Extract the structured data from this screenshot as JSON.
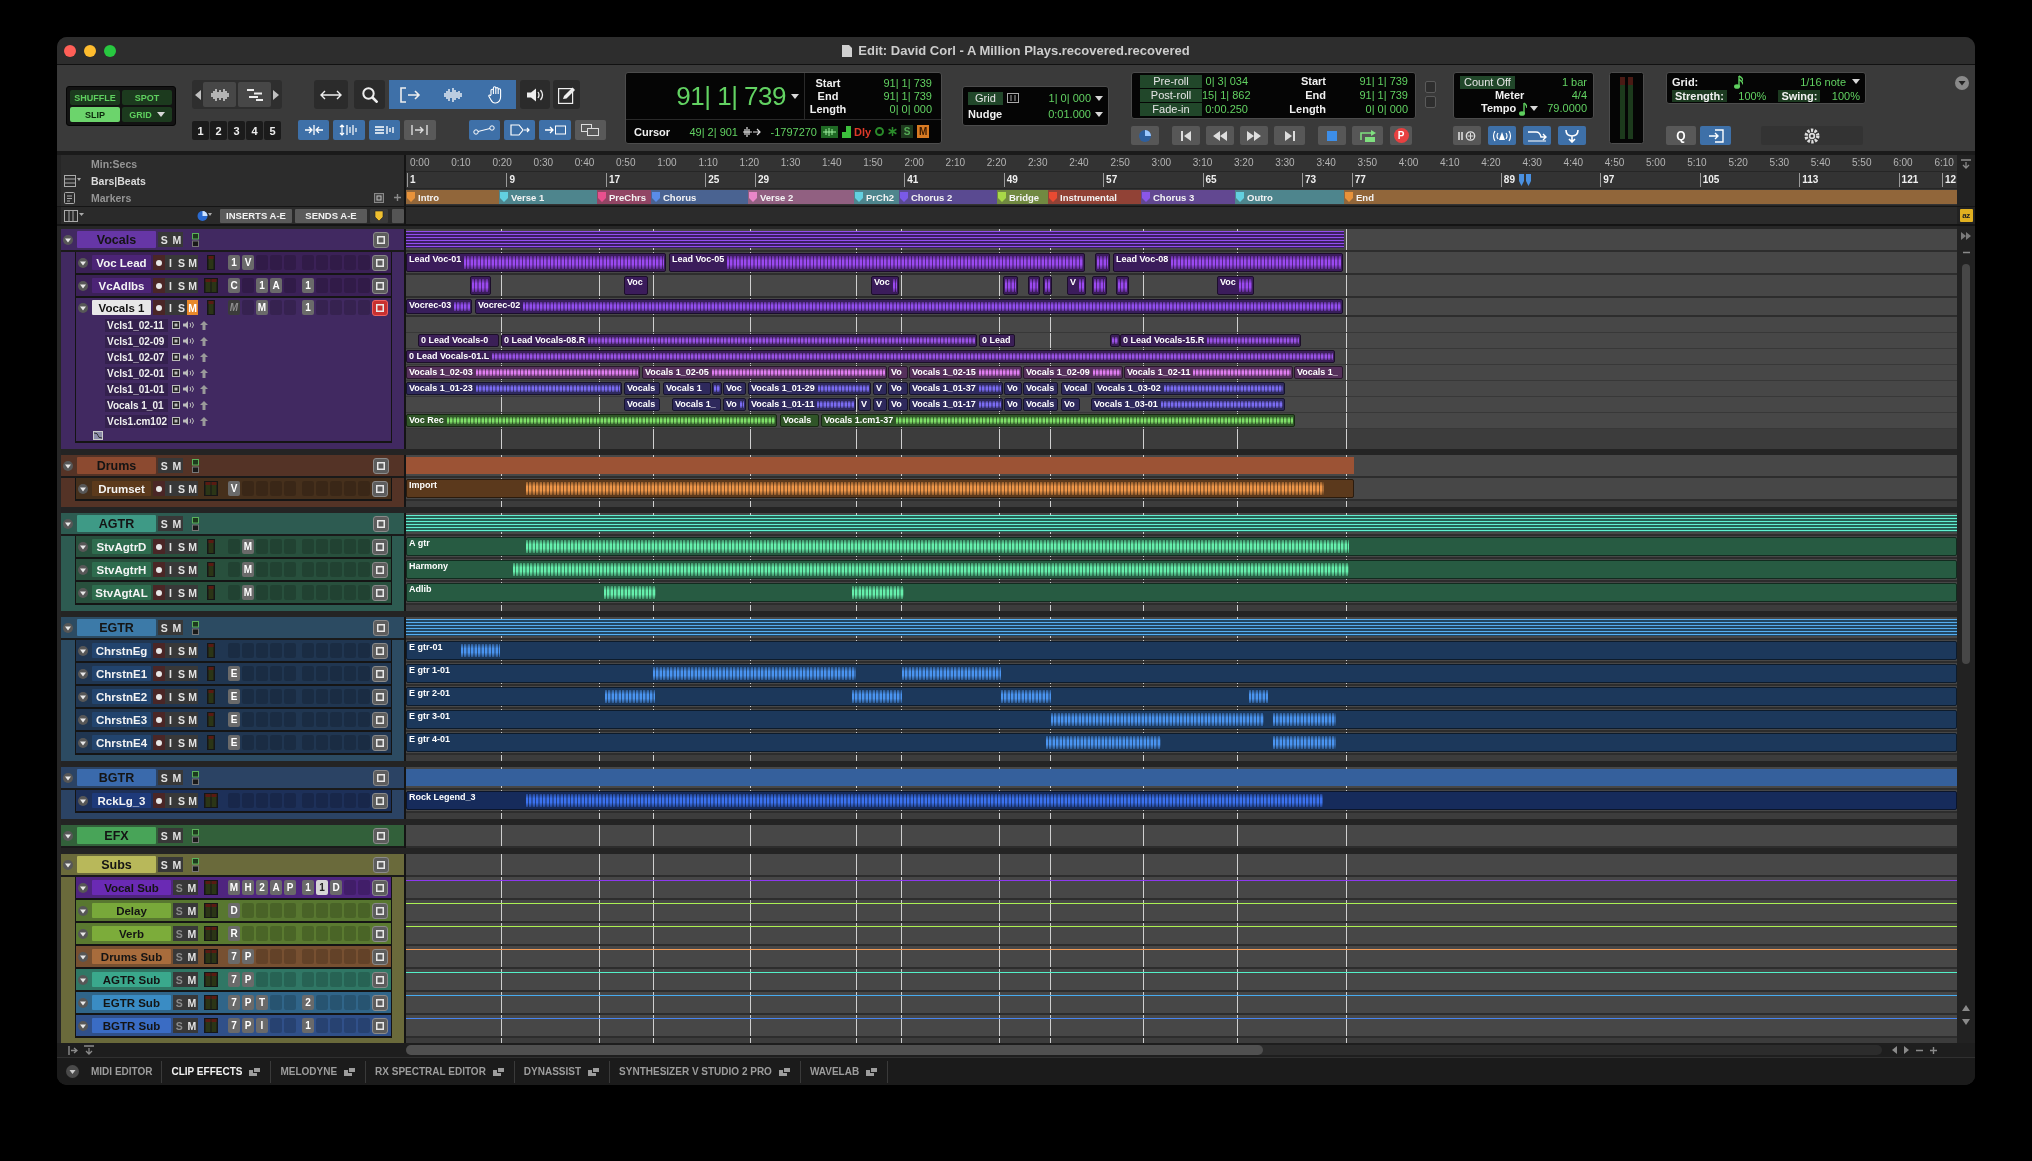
{
  "window": {
    "title": "Edit: David Corl - A Million Plays.recovered.recovered"
  },
  "toolbar": {
    "edit_modes": [
      {
        "label": "SHUFFLE",
        "selected": false,
        "menu": false
      },
      {
        "label": "SPOT",
        "selected": false,
        "menu": false
      },
      {
        "label": "SLIP",
        "selected": true,
        "menu": false
      },
      {
        "label": "GRID",
        "selected": false,
        "menu": true
      }
    ],
    "zoom_presets": [
      "1",
      "2",
      "3",
      "4",
      "5"
    ],
    "tools": [
      {
        "kind": "arrows",
        "selected": false
      },
      {
        "kind": "magnifier",
        "selected": false
      },
      {
        "kind": "trim",
        "selected": true
      },
      {
        "kind": "selector",
        "selected": true
      },
      {
        "kind": "hand",
        "selected": true
      },
      {
        "kind": "speaker",
        "selected": false
      },
      {
        "kind": "pencil",
        "selected": false
      }
    ],
    "edit_toggles": [
      {
        "kind": "split",
        "on": true
      },
      {
        "kind": "updown",
        "on": true
      },
      {
        "kind": "lines",
        "on": true
      },
      {
        "kind": "bracket",
        "on": false
      },
      {
        "kind": "nodes",
        "on": true
      },
      {
        "kind": "tag",
        "on": true
      },
      {
        "kind": "arrowbox",
        "on": true
      },
      {
        "kind": "windows",
        "on": false
      }
    ],
    "counter": {
      "main": "91| 1| 739",
      "rows": [
        {
          "label": "Start",
          "value": "91| 1| 739"
        },
        {
          "label": "End",
          "value": "91| 1| 739"
        },
        {
          "label": "Length",
          "value": "0| 0| 000"
        }
      ],
      "cursor_label": "Cursor",
      "cursor_value": "49| 2| 901",
      "sample_value": "-1797270",
      "delay_label": "Dly",
      "indicators": [
        {
          "label": "S",
          "on": false
        },
        {
          "label": "M",
          "on": true
        }
      ]
    },
    "grid_nudge": {
      "grid_label": "Grid",
      "grid_value": "1| 0| 000",
      "nudge_label": "Nudge",
      "nudge_value": "0:01.000"
    },
    "transport": {
      "rolls": [
        {
          "label": "Pre-roll",
          "value": "0| 3| 034"
        },
        {
          "label": "Post-roll",
          "value": "15| 1| 862"
        },
        {
          "label": "Fade-in",
          "value": "0:00.250"
        }
      ],
      "locations": [
        {
          "label": "Start",
          "value": "91| 1| 739"
        },
        {
          "label": "End",
          "value": "91| 1| 739"
        },
        {
          "label": "Length",
          "value": "0| 0| 000"
        }
      ],
      "record_label": "P"
    },
    "midi": {
      "count_off_label": "Count Off",
      "count_off_value": "1 bar",
      "meter_label": "Meter",
      "meter_value": "4/4",
      "tempo_label": "Tempo",
      "tempo_value": "79.0000",
      "toggles": [
        {
          "kind": "wait",
          "on": false
        },
        {
          "kind": "click",
          "on": true
        },
        {
          "kind": "merge",
          "on": true
        },
        {
          "kind": "input",
          "on": true
        }
      ]
    },
    "grid_panel": {
      "grid_label": "Grid:",
      "grid_value": "1/16 note",
      "strength_label": "Strength:",
      "strength_value": "100%",
      "swing_label": "Swing:",
      "swing_value": "100%",
      "quantize_label": "Q",
      "snap_on": true
    }
  },
  "rulers": {
    "min_secs": {
      "label": "Min:Secs",
      "ticks": [
        "0:00",
        "0:10",
        "0:20",
        "0:30",
        "0:40",
        "0:50",
        "1:00",
        "1:10",
        "1:20",
        "1:30",
        "1:40",
        "1:50",
        "2:00",
        "2:10",
        "2:20",
        "2:30",
        "2:40",
        "2:50",
        "3:00",
        "3:10",
        "3:20",
        "3:30",
        "3:40",
        "3:50",
        "4:00",
        "4:10",
        "4:20",
        "4:30",
        "4:40",
        "4:50",
        "5:00",
        "5:10",
        "5:20",
        "5:30",
        "5:40",
        "5:50",
        "6:00",
        "6:10"
      ]
    },
    "bars_beats": {
      "label": "Bars|Beats",
      "ticks": [
        "1",
        "9",
        "17",
        "25",
        "29",
        "41",
        "49",
        "57",
        "65",
        "73",
        "77",
        "89",
        "97",
        "105",
        "113",
        "121",
        "12"
      ]
    },
    "markers": {
      "label": "Markers",
      "items": [
        {
          "name": "Intro",
          "color": "#e8923a"
        },
        {
          "name": "Verse 1",
          "color": "#62d0e0"
        },
        {
          "name": "PreChrs",
          "color": "#e8508e"
        },
        {
          "name": "Chorus",
          "color": "#5a8ce8"
        },
        {
          "name": "Verse 2",
          "color": "#e886c8"
        },
        {
          "name": "PrCh2",
          "color": "#62d0e0"
        },
        {
          "name": "Chorus 2",
          "color": "#7a5ae8"
        },
        {
          "name": "Bridge",
          "color": "#a8d848"
        },
        {
          "name": "Instrumental",
          "color": "#e84a32"
        },
        {
          "name": "Chorus 3",
          "color": "#8a56e8"
        },
        {
          "name": "Outro",
          "color": "#62d0e0"
        },
        {
          "name": "End",
          "color": "#e8923a"
        }
      ]
    }
  },
  "column_header": {
    "inserts_label": "INSERTS A-E",
    "sends_label": "SENDS A-E",
    "sort_label": "az"
  },
  "tracks": [
    {
      "kind": "folder",
      "name": "Vocals",
      "color": "#6636a6",
      "selected": false,
      "muted": false,
      "playlists_on": false,
      "expanded": true,
      "controls": [
        "S",
        "M"
      ],
      "children": [
        {
          "kind": "audio",
          "name": "Voc Lead",
          "color": "#4c2476",
          "selected": false,
          "muted": false,
          "playlists_on": false,
          "stereo": false,
          "controls": [
            "I",
            "S",
            "M"
          ],
          "inserts": [
            {
              "kind": "plugin",
              "label": "1"
            },
            {
              "kind": "plugin",
              "label": "V"
            }
          ],
          "clips": [
            "Lead Voc-01",
            "Lead Voc-05",
            "Lead Voc-08"
          ]
        },
        {
          "kind": "audio",
          "name": "VcAdlbs",
          "color": "#4c2476",
          "selected": false,
          "muted": false,
          "playlists_on": false,
          "stereo": true,
          "controls": [
            "I",
            "S",
            "M"
          ],
          "inserts": [
            {
              "kind": "plugin",
              "label": "C"
            },
            {
              "kind": "empty"
            },
            {
              "kind": "plugin",
              "label": "1"
            },
            {
              "kind": "plugin",
              "label": "A"
            }
          ],
          "sends": [
            {
              "kind": "plugin",
              "label": "1"
            }
          ],
          "clips": [
            "Voc",
            "Voc",
            "V",
            "Voc"
          ]
        },
        {
          "kind": "audio",
          "name": "Vocals 1",
          "selected": true,
          "muted": true,
          "playlists_on": true,
          "stereo": false,
          "controls": [
            "I",
            "S",
            "M"
          ],
          "inserts": [
            {
              "kind": "inactive",
              "label": "M"
            },
            {
              "kind": "empty"
            },
            {
              "kind": "plugin",
              "label": "M"
            }
          ],
          "sends": [
            {
              "kind": "plugin",
              "label": "1"
            }
          ],
          "clips": [
            "Vocrec-03",
            "Vocrec-02"
          ],
          "playlists": [
            {
              "name": "Vcls1_02-11"
            },
            {
              "name": "Vcls1_02-09",
              "color": "#9a52e6",
              "clips": [
                "0 Lead Vocals-0",
                "0 Lead Vocals-08.R",
                "0 Lead",
                "0 Lead Vocals-15.R"
              ]
            },
            {
              "name": "Vcls1_02-07",
              "color": "#9a52e6",
              "clips": [
                "0 Lead Vocals-01.L"
              ]
            },
            {
              "name": "Vcls1_02-01",
              "color": "#e07ef0",
              "clips": [
                "Vocals 1_02-03",
                "Vocals 1_02-05",
                "Vo",
                "Vocals 1_02-15",
                "Vocals 1_02-09",
                "Vocals 1_02-11",
                "Vocals 1_"
              ]
            },
            {
              "name": "Vcls1_01-01",
              "color": "#7a6cf2",
              "clips": [
                "Vocals 1_01-23",
                "Vocals",
                "Vocals 1",
                "Voc",
                "Vocals 1_01-29",
                "V",
                "Vo",
                "Vocals 1_01-37",
                "Vo",
                "Vocals",
                "Vocal",
                "Vocals 1_03-02"
              ]
            },
            {
              "name": "Vocals 1_01",
              "color": "#7a6cf2",
              "clips": [
                "Vocals",
                "Vocals 1_",
                "Vo",
                "Vocals 1_01-11",
                "V",
                "V",
                "Vo",
                "Vocals 1_01-17",
                "Vo",
                "Vocals",
                "Vo",
                "Vocals 1_03-01"
              ]
            },
            {
              "name": "Vcls1.cm102",
              "color": "#7ee068",
              "clips": [
                "Voc Rec",
                "Vocals",
                "Vocals 1.cm1-37"
              ]
            }
          ]
        }
      ]
    },
    {
      "kind": "folder",
      "name": "Drums",
      "color": "#8c4a30",
      "selected": false,
      "muted": false,
      "playlists_on": false,
      "expanded": true,
      "controls": [
        "S",
        "M"
      ],
      "children": [
        {
          "kind": "audio",
          "name": "Drumset",
          "color": "#5c3a1c",
          "selected": false,
          "muted": false,
          "playlists_on": false,
          "stereo": true,
          "controls": [
            "I",
            "S",
            "M"
          ],
          "inserts": [
            {
              "kind": "plugin",
              "label": "V"
            }
          ],
          "clips": [
            "Import"
          ]
        }
      ]
    },
    {
      "kind": "folder",
      "name": "AGTR",
      "color": "#3e9a86",
      "selected": false,
      "muted": false,
      "playlists_on": false,
      "expanded": true,
      "controls": [
        "S",
        "M"
      ],
      "children": [
        {
          "kind": "audio",
          "name": "StvAgtrD",
          "color": "#2e6c4e",
          "selected": false,
          "muted": false,
          "playlists_on": false,
          "stereo": false,
          "controls": [
            "I",
            "S",
            "M"
          ],
          "inserts": [
            {
              "kind": "empty"
            },
            {
              "kind": "plugin",
              "label": "M"
            }
          ],
          "clips": [
            "A gtr"
          ]
        },
        {
          "kind": "audio",
          "name": "StvAgtrH",
          "color": "#2e6c4e",
          "selected": false,
          "muted": false,
          "playlists_on": false,
          "stereo": false,
          "controls": [
            "I",
            "S",
            "M"
          ],
          "inserts": [
            {
              "kind": "empty"
            },
            {
              "kind": "plugin",
              "label": "M"
            }
          ],
          "clips": [
            "Harmony"
          ]
        },
        {
          "kind": "audio",
          "name": "StvAgtAL",
          "color": "#2e6c4e",
          "selected": false,
          "muted": false,
          "playlists_on": false,
          "stereo": false,
          "controls": [
            "I",
            "S",
            "M"
          ],
          "inserts": [
            {
              "kind": "empty"
            },
            {
              "kind": "plugin",
              "label": "M"
            }
          ],
          "clips": [
            "Adlib"
          ]
        }
      ]
    },
    {
      "kind": "folder",
      "name": "EGTR",
      "color": "#3c7aa8",
      "selected": false,
      "muted": false,
      "playlists_on": false,
      "expanded": true,
      "controls": [
        "S",
        "M"
      ],
      "children": [
        {
          "kind": "audio",
          "name": "ChrstnEg",
          "color": "#22446e",
          "selected": false,
          "muted": false,
          "playlists_on": false,
          "stereo": false,
          "controls": [
            "I",
            "S",
            "M"
          ],
          "clips": [
            "E gtr-01"
          ]
        },
        {
          "kind": "audio",
          "name": "ChrstnE1",
          "color": "#22446e",
          "selected": false,
          "muted": false,
          "playlists_on": false,
          "stereo": false,
          "controls": [
            "I",
            "S",
            "M"
          ],
          "inserts": [
            {
              "kind": "plugin",
              "label": "E"
            }
          ],
          "clips": [
            "E gtr 1-01"
          ]
        },
        {
          "kind": "audio",
          "name": "ChrstnE2",
          "color": "#22446e",
          "selected": false,
          "muted": false,
          "playlists_on": false,
          "stereo": false,
          "controls": [
            "I",
            "S",
            "M"
          ],
          "inserts": [
            {
              "kind": "plugin",
              "label": "E"
            }
          ],
          "clips": [
            "E gtr 2-01"
          ]
        },
        {
          "kind": "audio",
          "name": "ChrstnE3",
          "color": "#22446e",
          "selected": false,
          "muted": false,
          "playlists_on": false,
          "stereo": false,
          "controls": [
            "I",
            "S",
            "M"
          ],
          "inserts": [
            {
              "kind": "plugin",
              "label": "E"
            }
          ],
          "clips": [
            "E gtr 3-01"
          ]
        },
        {
          "kind": "audio",
          "name": "ChrstnE4",
          "color": "#22446e",
          "selected": false,
          "muted": false,
          "playlists_on": false,
          "stereo": false,
          "controls": [
            "I",
            "S",
            "M"
          ],
          "inserts": [
            {
              "kind": "plugin",
              "label": "E"
            }
          ],
          "clips": [
            "E gtr 4-01"
          ]
        }
      ]
    },
    {
      "kind": "folder",
      "name": "BGTR",
      "color": "#3a6aac",
      "selected": false,
      "muted": false,
      "playlists_on": false,
      "expanded": true,
      "controls": [
        "S",
        "M"
      ],
      "children": [
        {
          "kind": "audio",
          "name": "RckLg_3",
          "color": "#1e3a7a",
          "selected": false,
          "muted": false,
          "playlists_on": false,
          "stereo": true,
          "controls": [
            "I",
            "S",
            "M"
          ],
          "clips": [
            "Rock Legend_3"
          ]
        }
      ]
    },
    {
      "kind": "folder",
      "name": "EFX",
      "color": "#48a458",
      "selected": false,
      "muted": false,
      "playlists_on": false,
      "expanded": true,
      "controls": [
        "S",
        "M"
      ]
    },
    {
      "kind": "folder",
      "name": "Subs",
      "color": "#b8b85a",
      "selected": false,
      "muted": false,
      "playlists_on": false,
      "expanded": true,
      "controls": [
        "S",
        "M"
      ],
      "children": [
        {
          "kind": "aux",
          "name": "Vocal Sub",
          "color": "#6a2ab4",
          "selected": false,
          "muted": false,
          "playlists_on": false,
          "stereo": true,
          "controls": [
            "S",
            "M"
          ],
          "inserts": [
            {
              "kind": "plugin",
              "label": "M"
            },
            {
              "kind": "plugin",
              "label": "H"
            },
            {
              "kind": "plugin",
              "label": "2"
            },
            {
              "kind": "plugin",
              "label": "A"
            },
            {
              "kind": "plugin",
              "label": "P"
            }
          ],
          "sends": [
            {
              "kind": "plugin",
              "label": "1"
            },
            {
              "kind": "active",
              "label": "1"
            },
            {
              "kind": "plugin",
              "label": "D"
            }
          ]
        },
        {
          "kind": "aux",
          "name": "Delay",
          "color": "#78a83a",
          "selected": false,
          "muted": false,
          "playlists_on": false,
          "stereo": true,
          "controls": [
            "S",
            "M"
          ],
          "inserts": [
            {
              "kind": "plugin",
              "label": "D"
            }
          ]
        },
        {
          "kind": "aux",
          "name": "Verb",
          "color": "#7cac3a",
          "selected": false,
          "muted": false,
          "playlists_on": false,
          "stereo": true,
          "controls": [
            "S",
            "M"
          ],
          "inserts": [
            {
              "kind": "plugin",
              "label": "R"
            }
          ]
        },
        {
          "kind": "aux",
          "name": "Drums Sub",
          "color": "#a86c3c",
          "selected": false,
          "muted": false,
          "playlists_on": false,
          "stereo": true,
          "controls": [
            "S",
            "M"
          ],
          "inserts": [
            {
              "kind": "plugin",
              "label": "7"
            },
            {
              "kind": "plugin",
              "label": "P"
            }
          ]
        },
        {
          "kind": "aux",
          "name": "AGTR Sub",
          "color": "#3aa88c",
          "selected": false,
          "muted": false,
          "playlists_on": false,
          "stereo": true,
          "controls": [
            "S",
            "M"
          ],
          "inserts": [
            {
              "kind": "plugin",
              "label": "7"
            },
            {
              "kind": "plugin",
              "label": "P"
            }
          ]
        },
        {
          "kind": "aux",
          "name": "EGTR Sub",
          "color": "#3a8cc4",
          "selected": false,
          "muted": false,
          "playlists_on": false,
          "stereo": true,
          "controls": [
            "S",
            "M"
          ],
          "inserts": [
            {
              "kind": "plugin",
              "label": "7"
            },
            {
              "kind": "plugin",
              "label": "P"
            },
            {
              "kind": "plugin",
              "label": "T"
            }
          ],
          "sends": [
            {
              "kind": "plugin",
              "label": "2"
            }
          ]
        },
        {
          "kind": "aux",
          "name": "BGTR Sub",
          "color": "#3a6cc4",
          "selected": false,
          "muted": false,
          "playlists_on": false,
          "stereo": true,
          "controls": [
            "S",
            "M"
          ],
          "inserts": [
            {
              "kind": "plugin",
              "label": "7"
            },
            {
              "kind": "plugin",
              "label": "P"
            },
            {
              "kind": "plugin",
              "label": "I"
            }
          ],
          "sends": [
            {
              "kind": "plugin",
              "label": "1"
            }
          ]
        }
      ]
    }
  ],
  "bottom_tabs": [
    {
      "label": "MIDI EDITOR",
      "selected": false,
      "pop_out": false
    },
    {
      "label": "CLIP EFFECTS",
      "selected": true,
      "pop_out": true
    },
    {
      "label": "MELODYNE",
      "selected": false,
      "pop_out": true
    },
    {
      "label": "RX SPECTRAL EDITOR",
      "selected": false,
      "pop_out": true
    },
    {
      "label": "DYNASSIST",
      "selected": false,
      "pop_out": true
    },
    {
      "label": "SYNTHESIZER V STUDIO 2 PRO",
      "selected": false,
      "pop_out": true
    },
    {
      "label": "WAVELAB",
      "selected": false,
      "pop_out": true
    }
  ]
}
